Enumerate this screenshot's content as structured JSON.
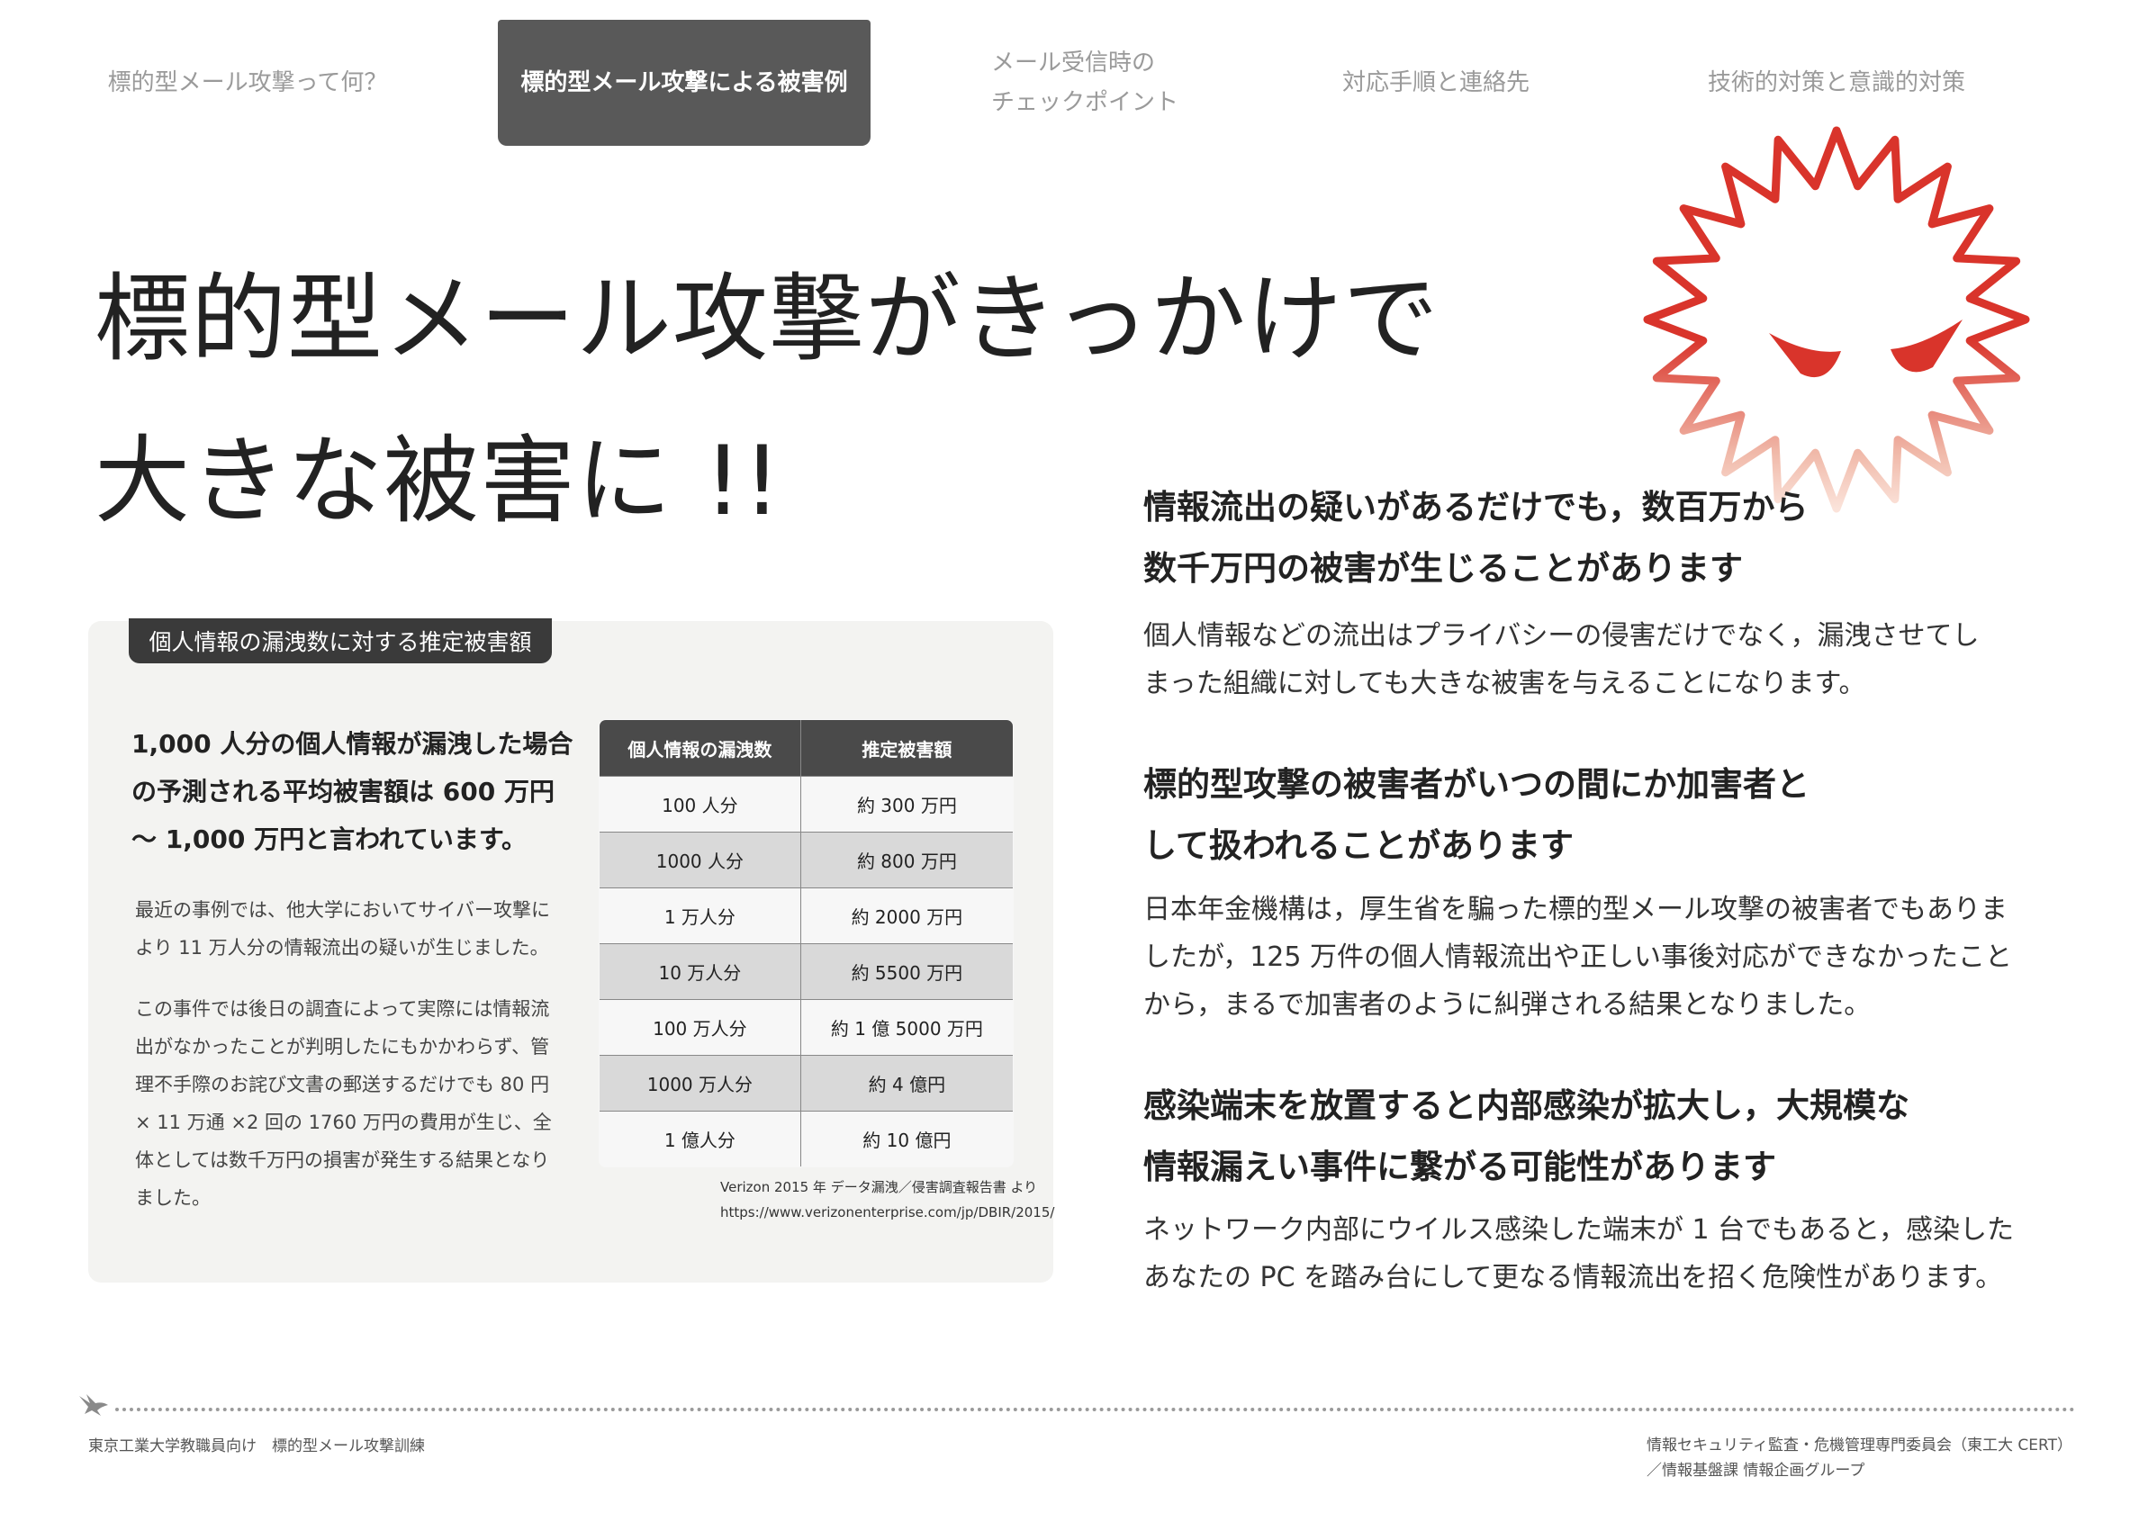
{
  "nav": {
    "tabs": [
      {
        "lines": [
          "標的型メール攻撃って何？"
        ]
      },
      {
        "lines": [
          "標的型メール攻撃による被害例"
        ],
        "active": true
      },
      {
        "lines": [
          "メール受信時の",
          "チェックポイント"
        ]
      },
      {
        "lines": [
          "対応手順と連絡先"
        ]
      },
      {
        "lines": [
          "技術的対策と意識的対策"
        ]
      }
    ]
  },
  "headline": {
    "lines": [
      "標的型メール攻撃がきっかけで",
      "大きな被害に !!"
    ]
  },
  "panel": {
    "tab_label": "個人情報の漏洩数に対する推定被害額",
    "lead_lines": [
      "1,000 人分の個人情報が漏洩した場合",
      "の予測される平均被害額は 600 万円",
      "～ 1,000 万円と言われています。"
    ],
    "p1_lines": [
      "最近の事例では、他大学においてサイバー攻撃に",
      "より 11 万人分の情報流出の疑いが生じました。"
    ],
    "p2_lines": [
      "この事件では後日の調査によって実際には情報流",
      "出がなかったことが判明したにもかかわらず、管",
      "理不手際のお詫び文書の郵送するだけでも 80 円",
      "× 11 万通 ×2 回の 1760 万円の費用が生じ、全",
      "体としては数千万円の損害が発生する結果となり",
      "ました。"
    ],
    "table": {
      "headers": [
        "個人情報の漏洩数",
        "推定被害額"
      ],
      "rows": [
        [
          "100 人分",
          "約 300 万円"
        ],
        [
          "1000 人分",
          "約 800 万円"
        ],
        [
          "1 万人分",
          "約 2000 万円"
        ],
        [
          "10 万人分",
          "約 5500 万円"
        ],
        [
          "100 万人分",
          "約 1 億 5000 万円"
        ],
        [
          "1000 万人分",
          "約 4 億円"
        ],
        [
          "1 億人分",
          "約 10 億円"
        ]
      ]
    },
    "source_lines": [
      "Verizon 2015 年 データ漏洩／侵害調査報告書 より",
      "https://www.verizonenterprise.com/jp/DBIR/2015/"
    ]
  },
  "sections": [
    {
      "title_lines": [
        "情報流出の疑いがあるだけでも，数百万から",
        "数千万円の被害が生じることがあります"
      ],
      "body_lines": [
        "個人情報などの流出はプライバシーの侵害だけでなく，漏洩させてし",
        "まった組織に対しても大きな被害を与えることになります。"
      ]
    },
    {
      "title_lines": [
        "標的型攻撃の被害者がいつの間にか加害者と",
        "して扱われることがあります"
      ],
      "body_lines": [
        "日本年金機構は，厚生省を騙った標的型メール攻撃の被害者でもありま",
        "したが，125 万件の個人情報流出や正しい事後対応ができなかったこと",
        "から，まるで加害者のように糾弾される結果となりました。"
      ]
    },
    {
      "title_lines": [
        "感染端末を放置すると内部感染が拡大し，大規模な",
        "情報漏えい事件に繋がる可能性があります"
      ],
      "body_lines": [
        "ネットワーク内部にウイルス感染した端末が 1 台でもあると，感染した",
        "あなたの PC を踏み台にして更なる情報流出を招く危険性があります。"
      ]
    }
  ],
  "footer": {
    "left": "東京工業大学教職員向け　標的型メール攻撃訓練",
    "right_lines": [
      "情報セキュリティ監査・危機管理専門委員会（東工大 CERT）",
      "／情報基盤課 情報企画グループ"
    ]
  },
  "colors": {
    "accent_dark": "#595959",
    "mascot_red": "#d9342b",
    "mascot_fade": "#f0b8a8",
    "panel_bg": "#f3f3f1"
  },
  "icons": {
    "mascot": "virus-mascot-icon",
    "footer_bird": "swallow-bird-icon"
  }
}
